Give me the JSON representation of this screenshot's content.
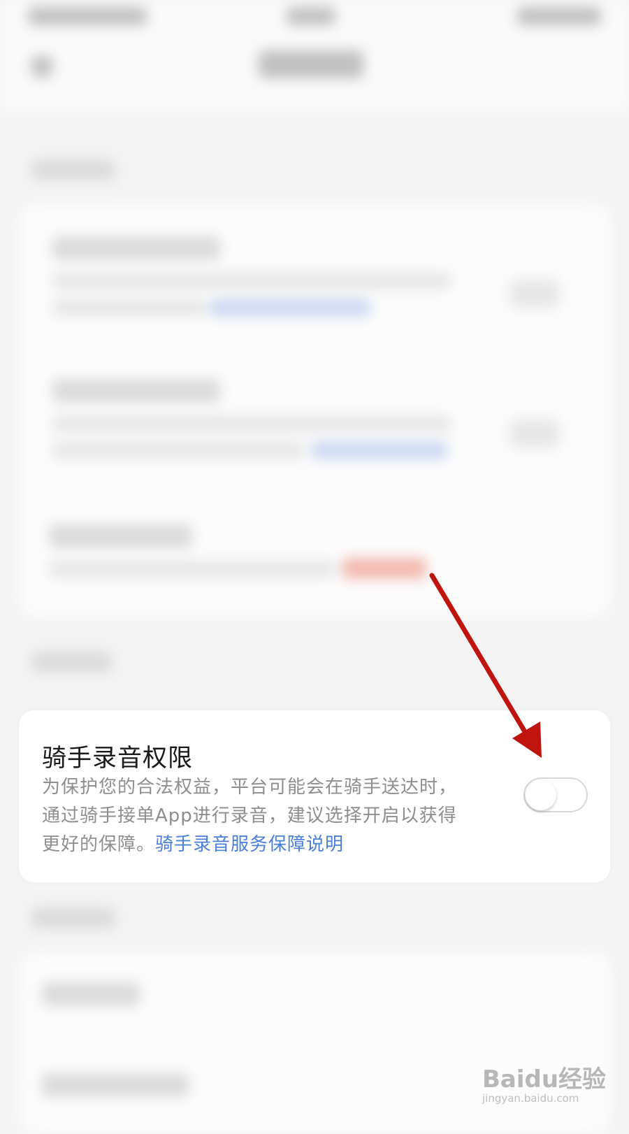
{
  "card": {
    "title": "骑手录音权限",
    "description": "为保护您的合法权益，平台可能会在骑手送达时，通过骑手接单App进行录音，建议选择开启以获得更好的保障。",
    "link": "骑手录音服务保障说明",
    "toggle_state": "off"
  },
  "watermark": {
    "text": "Baidu经验",
    "url": "jingyan.baidu.com"
  },
  "colors": {
    "link": "#4a7fd9",
    "arrow": "#c0140f",
    "card_bg": "#ffffff",
    "page_bg": "#f4f4f4"
  }
}
